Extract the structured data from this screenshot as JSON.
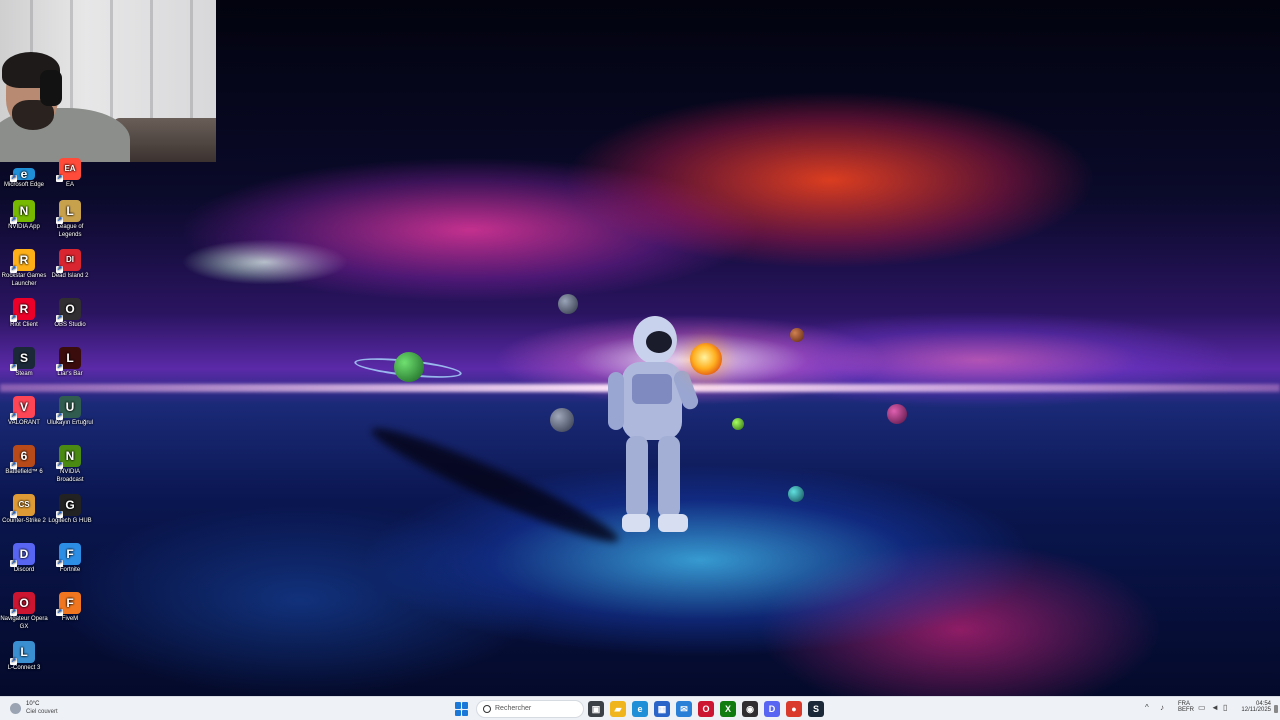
{
  "desktop": {
    "icons": [
      {
        "label": "Microsoft Edge",
        "glyph": "e",
        "color": "#1f8fd8",
        "icon": "microsoft-edge-icon"
      },
      {
        "label": "EA",
        "glyph": "EA",
        "color": "#ff4b3a",
        "icon": "ea-icon"
      },
      {
        "label": "NVIDIA App",
        "glyph": "N",
        "color": "#76b900",
        "icon": "nvidia-app-icon"
      },
      {
        "label": "League of Legends",
        "glyph": "L",
        "color": "#c8a14c",
        "icon": "league-of-legends-icon"
      },
      {
        "label": "Rockstar Games Launcher",
        "glyph": "R",
        "color": "#fcaf17",
        "icon": "rockstar-icon"
      },
      {
        "label": "Dead Island 2",
        "glyph": "DI",
        "color": "#d8252f",
        "icon": "dead-island-icon"
      },
      {
        "label": "Riot Client",
        "glyph": "R",
        "color": "#eb0029",
        "icon": "riot-client-icon"
      },
      {
        "label": "OBS Studio",
        "glyph": "O",
        "color": "#302e31",
        "icon": "obs-icon"
      },
      {
        "label": "Steam",
        "glyph": "S",
        "color": "#1b2838",
        "icon": "steam-icon"
      },
      {
        "label": "Liar's Bar",
        "glyph": "L",
        "color": "#3a0c0c",
        "icon": "liars-bar-icon"
      },
      {
        "label": "VALORANT",
        "glyph": "V",
        "color": "#fd4556",
        "icon": "valorant-icon"
      },
      {
        "label": "Ulukayın Ertuğrul",
        "glyph": "U",
        "color": "#2f5c4e",
        "icon": "ertugrul-icon"
      },
      {
        "label": "Battlefield™ 6",
        "glyph": "6",
        "color": "#b84a1a",
        "icon": "battlefield-icon"
      },
      {
        "label": "NVIDIA Broadcast",
        "glyph": "N",
        "color": "#4a8a12",
        "icon": "nvidia-broadcast-icon"
      },
      {
        "label": "Counter-Strike 2",
        "glyph": "CS",
        "color": "#de9b35",
        "icon": "counter-strike-icon"
      },
      {
        "label": "Logitech G HUB",
        "glyph": "G",
        "color": "#222222",
        "icon": "logitech-ghub-icon"
      },
      {
        "label": "Discord",
        "glyph": "D",
        "color": "#5865f2",
        "icon": "discord-icon"
      },
      {
        "label": "Fortnite",
        "glyph": "F",
        "color": "#2d8ee6",
        "icon": "fortnite-icon"
      },
      {
        "label": "Navigateur Opera GX",
        "glyph": "O",
        "color": "#cc1530",
        "icon": "opera-gx-icon"
      },
      {
        "label": "FiveM",
        "glyph": "F",
        "color": "#f0771f",
        "icon": "fivem-icon"
      },
      {
        "label": "L-Connect 3",
        "glyph": "L",
        "color": "#3a8fd0",
        "icon": "l-connect-icon"
      }
    ]
  },
  "taskbar": {
    "weather": {
      "temp": "10°C",
      "desc": "Ciel couvert"
    },
    "search_placeholder": "Rechercher",
    "apps": [
      {
        "name": "task-view-icon",
        "glyph": "▣",
        "color": "#3b3f46"
      },
      {
        "name": "file-explorer-icon",
        "glyph": "▰",
        "color": "#f0b41c"
      },
      {
        "name": "edge-icon",
        "glyph": "e",
        "color": "#1f8fd8"
      },
      {
        "name": "store-icon",
        "glyph": "▦",
        "color": "#2b64c8"
      },
      {
        "name": "app-icon",
        "glyph": "✉",
        "color": "#2a7fd6"
      },
      {
        "name": "opera-gx-icon",
        "glyph": "O",
        "color": "#cc1530"
      },
      {
        "name": "xbox-icon",
        "glyph": "X",
        "color": "#107c10"
      },
      {
        "name": "obs-icon",
        "glyph": "◉",
        "color": "#302e31"
      },
      {
        "name": "discord-icon",
        "glyph": "D",
        "color": "#5865f2"
      },
      {
        "name": "chrome-icon",
        "glyph": "●",
        "color": "#d93a2c"
      },
      {
        "name": "steam-icon",
        "glyph": "S",
        "color": "#1b2838"
      }
    ],
    "tray": {
      "lang": "FRA",
      "layout": "BEFR",
      "time": "04:54",
      "date": "12/11/2025"
    }
  }
}
